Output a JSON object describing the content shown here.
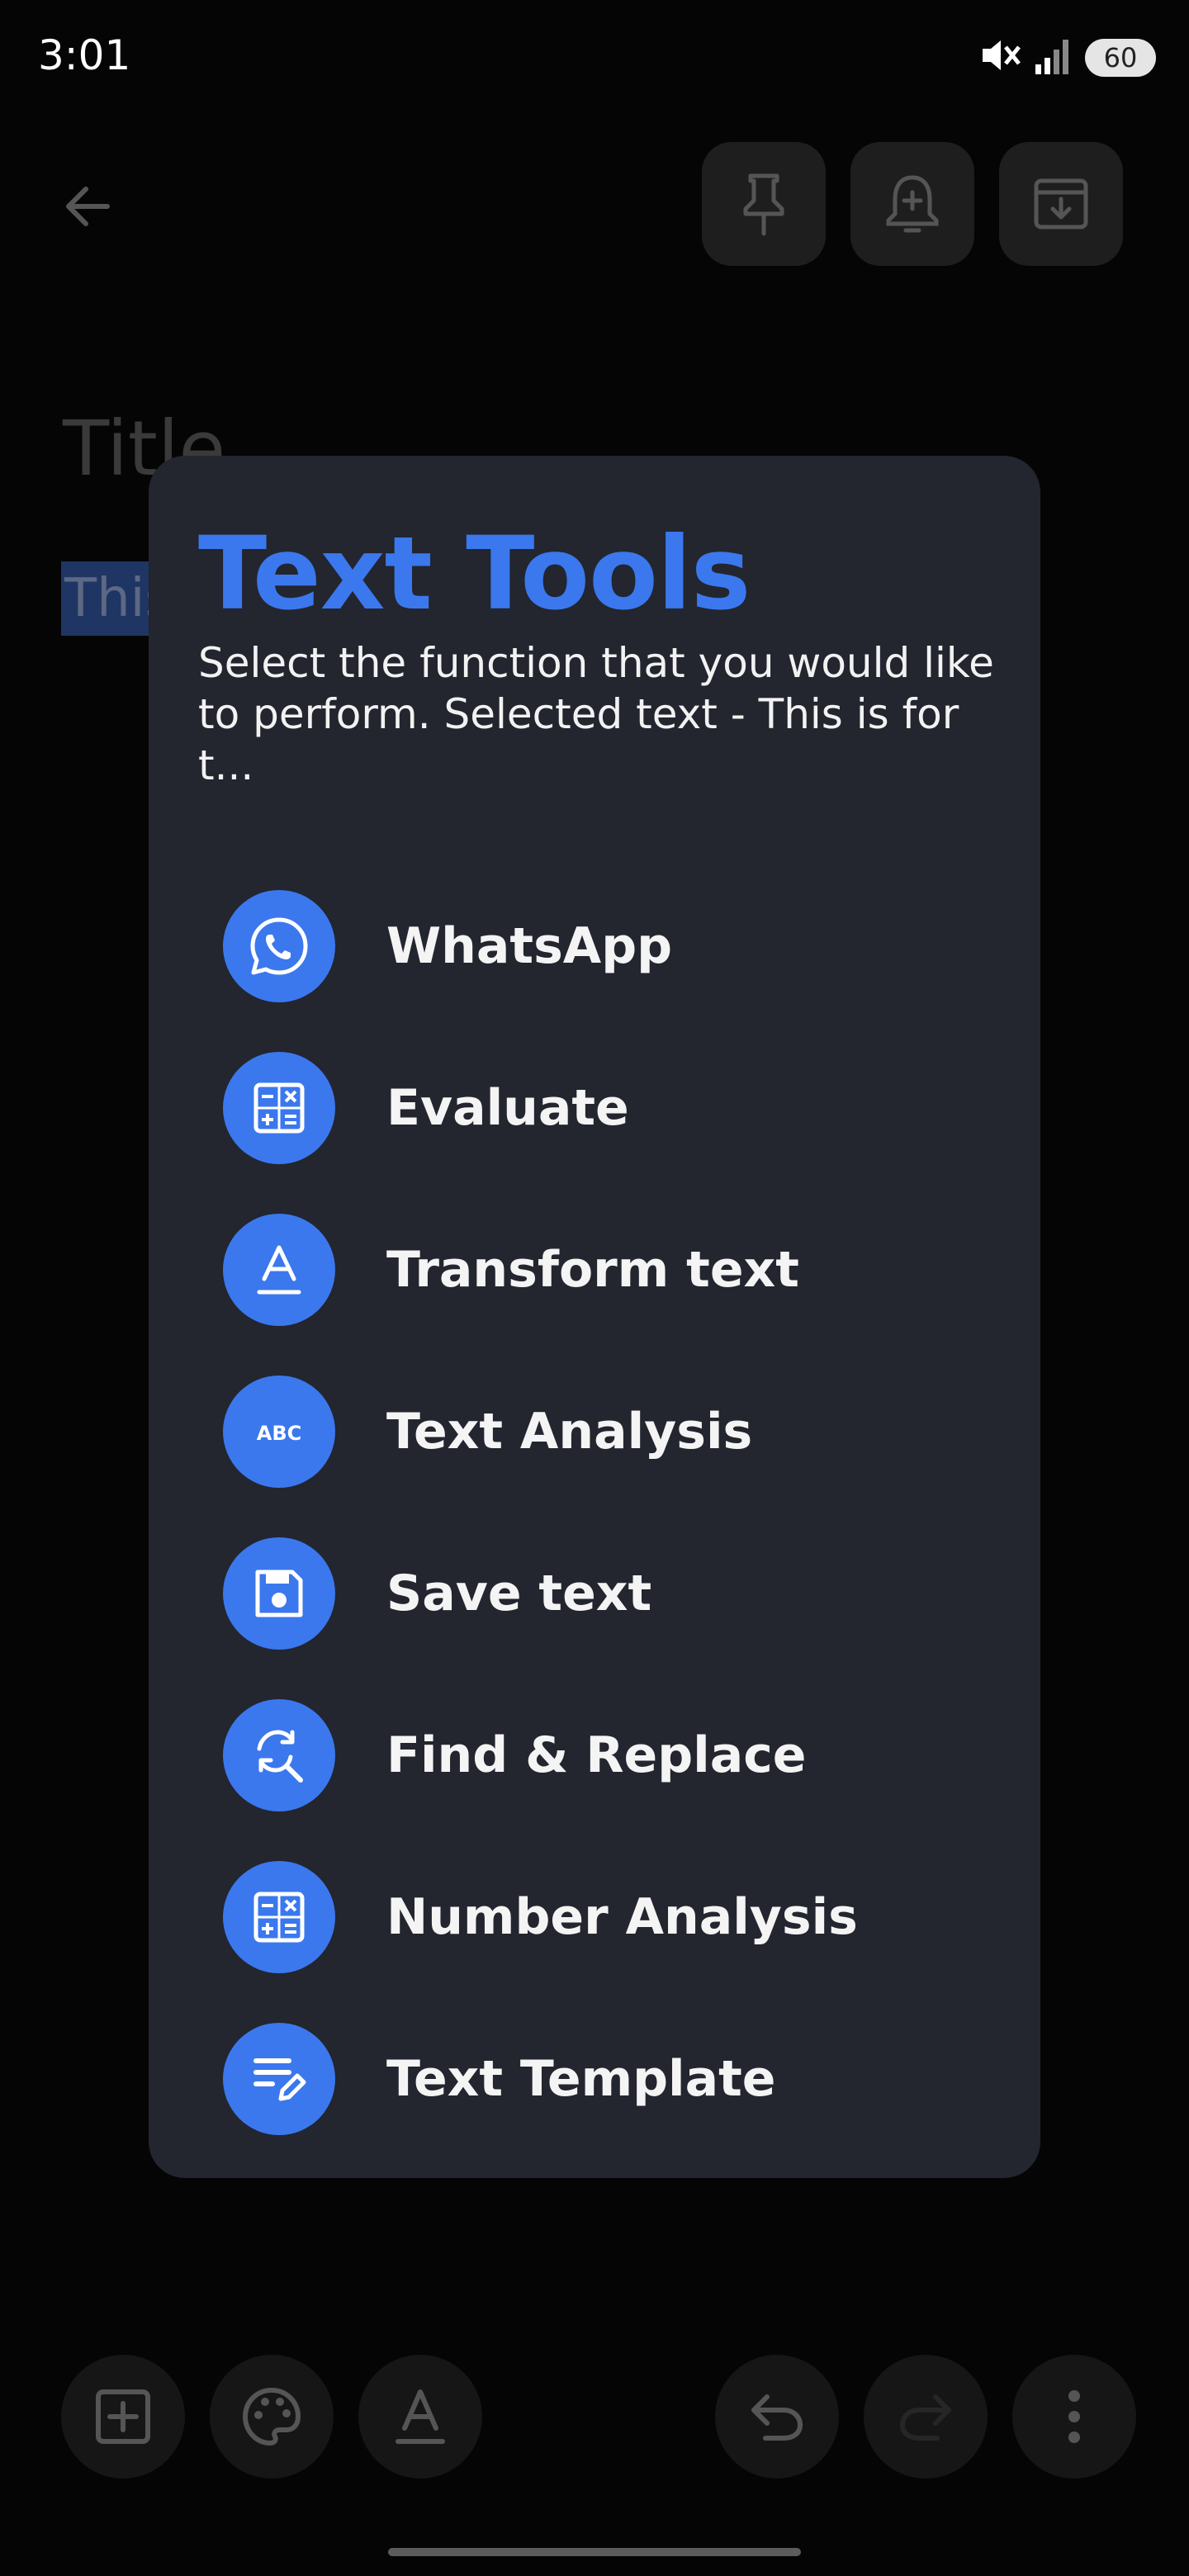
{
  "status_bar": {
    "time": "3:01",
    "battery": "60",
    "icons": [
      "mute-icon",
      "signal-icon",
      "battery-icon"
    ]
  },
  "header": {
    "back_icon": "arrow-back-icon",
    "actions": [
      "pin-icon",
      "add-reminder-icon",
      "archive-icon"
    ]
  },
  "note": {
    "title_placeholder": "Title",
    "body_visible_text": "This"
  },
  "dialog": {
    "title": "Text Tools",
    "subtitle": "Select the function that you would like to perform. Selected text - This is for t...",
    "accent_color": "#3b78ee",
    "tools": [
      {
        "label": "WhatsApp",
        "icon": "whatsapp-icon"
      },
      {
        "label": "Evaluate",
        "icon": "calculator-icon"
      },
      {
        "label": "Transform text",
        "icon": "text-format-icon"
      },
      {
        "label": "Text Analysis",
        "icon": "abc-icon"
      },
      {
        "label": "Save text",
        "icon": "save-icon"
      },
      {
        "label": "Find & Replace",
        "icon": "find-replace-icon"
      },
      {
        "label": "Number Analysis",
        "icon": "calculator-icon"
      },
      {
        "label": "Text Template",
        "icon": "edit-note-icon"
      }
    ]
  },
  "bottom_toolbar": {
    "left": [
      "add-box-icon",
      "palette-icon",
      "text-format-icon"
    ],
    "right": [
      "undo-icon",
      "redo-icon",
      "more-vert-icon"
    ]
  }
}
